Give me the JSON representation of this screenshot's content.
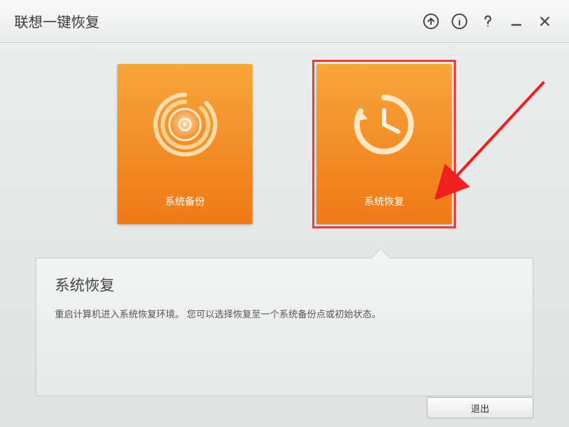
{
  "header": {
    "title": "联想一键恢复"
  },
  "cards": {
    "backup": {
      "label": "系统备份"
    },
    "restore": {
      "label": "系统恢复"
    }
  },
  "panel": {
    "title": "系统恢复",
    "body": "重启计算机进入系统恢复环境。 您可以选择恢复至一个系统备份点或初始状态。"
  },
  "buttons": {
    "exit": "退出"
  }
}
